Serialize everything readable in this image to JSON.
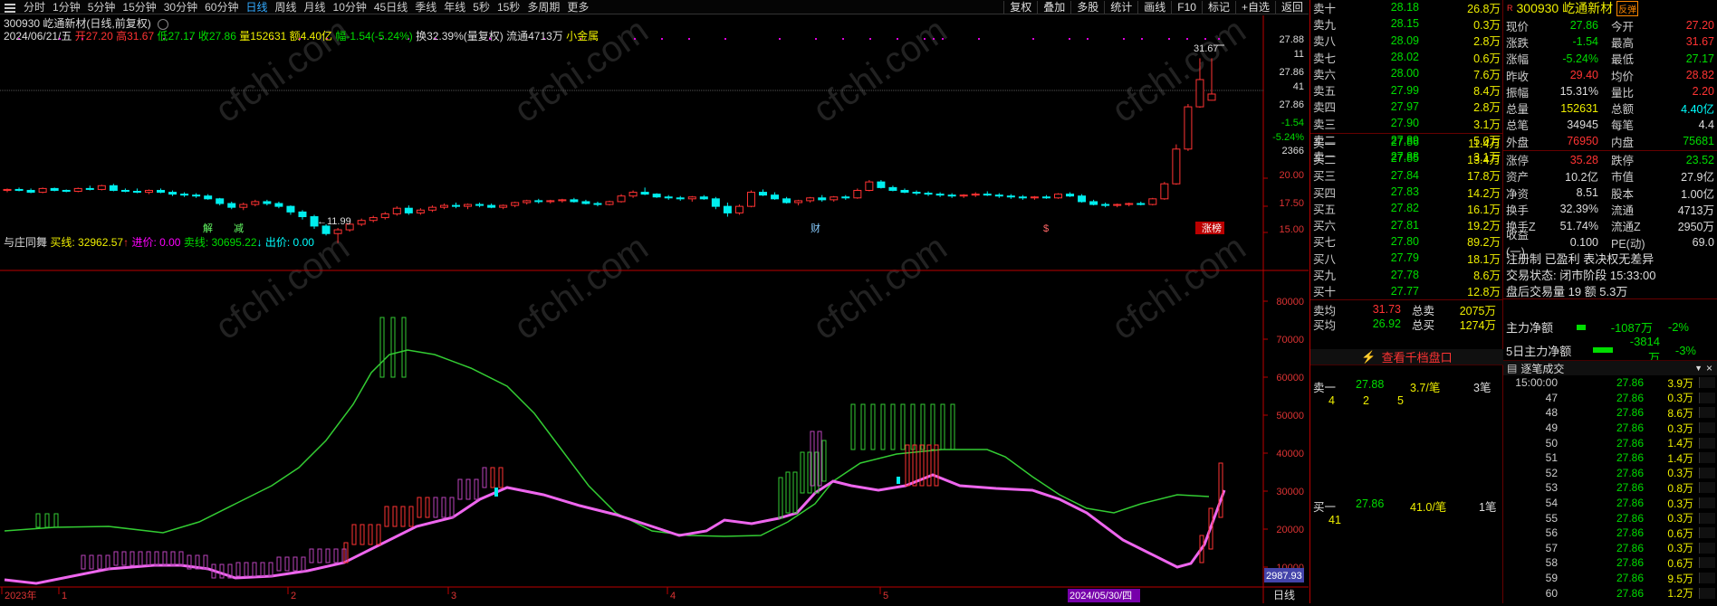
{
  "toolbar": {
    "periods": [
      "分时",
      "1分钟",
      "5分钟",
      "15分钟",
      "30分钟",
      "60分钟",
      "日线",
      "周线",
      "月线",
      "10分钟",
      "45日线",
      "季线",
      "年线",
      "5秒",
      "15秒",
      "多周期",
      "更多"
    ],
    "active": "日线",
    "buttons": [
      "复权",
      "叠加",
      "多股",
      "统计",
      "画线",
      "F10",
      "标记",
      "+自选",
      "返回"
    ]
  },
  "chart_header": {
    "title": "300930 屹通新材(日线,前复权)",
    "date": "2024/06/21/五",
    "open": "开27.20",
    "high": "高31.67",
    "low": "低27.17",
    "close": "收27.86",
    "volume": "量152631",
    "amount": "额4.40亿",
    "change": "幅-1.54(-5.24%)",
    "turnover": "换32.39%(量复权)",
    "float": "流通4713万",
    "tag": "小金属"
  },
  "price_axis": {
    "ticks": [
      "27.88",
      "11",
      "27.86",
      "41",
      "27.86",
      "-1.54",
      "-5.24%",
      "2366",
      "20.00",
      "17.50",
      "15.00"
    ]
  },
  "price_labels": {
    "high": "31.67",
    "low": "11.99"
  },
  "event_marks": [
    "解",
    "减",
    "财",
    "$",
    "涨榜"
  ],
  "indicator": {
    "name": "与庄同舞",
    "buy": "买线: 32962.57",
    "buy_arrow": "↑",
    "in_price": "进价: 0.00",
    "sell": "卖线: 30695.22",
    "sell_arrow": "↓",
    "out_price": "出价: 0.00",
    "yticks": [
      "80000",
      "70000",
      "60000",
      "50000",
      "40000",
      "30000",
      "20000",
      "10000"
    ],
    "cursor_value": "2987.93"
  },
  "xaxis": {
    "labels": [
      "2023年",
      "1",
      "2",
      "3",
      "4",
      "5"
    ],
    "date_label": "2024/05/30/四",
    "period_label": "日线"
  },
  "quote": {
    "code": "300930",
    "name": "屹通新材",
    "badge": "R",
    "tag": "反弹",
    "sells": [
      {
        "label": "卖十",
        "price": "28.18",
        "vol": "26.8万"
      },
      {
        "label": "卖九",
        "price": "28.15",
        "vol": "0.3万"
      },
      {
        "label": "卖八",
        "price": "28.09",
        "vol": "2.8万"
      },
      {
        "label": "卖七",
        "price": "28.02",
        "vol": "0.6万"
      },
      {
        "label": "卖六",
        "price": "28.00",
        "vol": "7.6万"
      },
      {
        "label": "卖五",
        "price": "27.99",
        "vol": "8.4万"
      },
      {
        "label": "卖四",
        "price": "27.97",
        "vol": "2.8万"
      },
      {
        "label": "卖三",
        "price": "27.90",
        "vol": "3.1万"
      },
      {
        "label": "卖二",
        "price": "27.89",
        "vol": "5.0万"
      },
      {
        "label": "卖一",
        "price": "27.88",
        "vol": "3.1万"
      }
    ],
    "buys": [
      {
        "label": "买一",
        "price": "27.86",
        "vol": "11.4万"
      },
      {
        "label": "买二",
        "price": "27.85",
        "vol": "13.4万"
      },
      {
        "label": "买三",
        "price": "27.84",
        "vol": "17.8万"
      },
      {
        "label": "买四",
        "price": "27.83",
        "vol": "14.2万"
      },
      {
        "label": "买五",
        "price": "27.82",
        "vol": "16.1万"
      },
      {
        "label": "买六",
        "price": "27.81",
        "vol": "19.2万"
      },
      {
        "label": "买七",
        "price": "27.80",
        "vol": "89.2万"
      },
      {
        "label": "买八",
        "price": "27.79",
        "vol": "18.1万"
      },
      {
        "label": "买九",
        "price": "27.78",
        "vol": "8.6万"
      },
      {
        "label": "买十",
        "price": "27.77",
        "vol": "12.8万"
      }
    ],
    "avg": [
      {
        "label": "卖均",
        "price": "31.73",
        "l2": "总卖",
        "v2": "2075万"
      },
      {
        "label": "买均",
        "price": "26.92",
        "l2": "总买",
        "v2": "1274万"
      }
    ],
    "stats": [
      {
        "l": "现价",
        "v": "27.86",
        "l2": "今开",
        "v2": "27.20"
      },
      {
        "l": "涨跌",
        "v": "-1.54",
        "l2": "最高",
        "v2": "31.67"
      },
      {
        "l": "涨幅",
        "v": "-5.24%",
        "l2": "最低",
        "v2": "27.17"
      },
      {
        "l": "昨收",
        "v": "29.40",
        "l2": "均价",
        "v2": "28.82"
      },
      {
        "l": "振幅",
        "v": "15.31%",
        "l2": "量比",
        "v2": "2.20"
      },
      {
        "l": "总量",
        "v": "152631",
        "l2": "总额",
        "v2": "4.40亿"
      },
      {
        "l": "总笔",
        "v": "34945",
        "l2": "每笔",
        "v2": "4.4"
      },
      {
        "l": "外盘",
        "v": "76950",
        "l2": "内盘",
        "v2": "75681"
      },
      {
        "l": "涨停",
        "v": "35.28",
        "l2": "跌停",
        "v2": "23.52"
      },
      {
        "l": "资产",
        "v": "10.2亿",
        "l2": "市值",
        "v2": "27.9亿"
      },
      {
        "l": "净资",
        "v": "8.51",
        "l2": "股本",
        "v2": "1.00亿"
      },
      {
        "l": "换手",
        "v": "32.39%",
        "l2": "流通",
        "v2": "4713万"
      },
      {
        "l": "换手Z",
        "v": "51.74%",
        "l2": "流通Z",
        "v2": "2950万"
      },
      {
        "l": "收益(一)",
        "v": "0.100",
        "l2": "PE(动)",
        "v2": "69.0"
      }
    ],
    "reg_text": "注册制 已盈利 表决权无差异",
    "trade_state": "交易状态: 闭市阶段 15:33:00",
    "after_hours": "盘后交易量 19 额 5.3万",
    "main_flow": {
      "l": "主力净额",
      "v": "-1087万",
      "p": "-2%"
    },
    "flow5": {
      "l": "5日主力净额",
      "v": "-3814万",
      "p": "-3%"
    }
  },
  "level2": {
    "header": "查看千档盘口",
    "sell1": {
      "label": "卖一",
      "price": "27.88",
      "vol": "3.7/笔",
      "count": "3笔",
      "detail": [
        "4",
        "2",
        "5"
      ]
    },
    "buy1": {
      "label": "买一",
      "price": "27.86",
      "vol": "41.0/笔",
      "count": "1笔",
      "detail": [
        "41"
      ]
    }
  },
  "ticks": {
    "title": "逐笔成交",
    "rows": [
      {
        "t": "15:00:00",
        "p": "27.86",
        "v": "3.9万"
      },
      {
        "t": "47",
        "p": "27.86",
        "v": "0.3万"
      },
      {
        "t": "48",
        "p": "27.86",
        "v": "8.6万"
      },
      {
        "t": "49",
        "p": "27.86",
        "v": "0.3万"
      },
      {
        "t": "50",
        "p": "27.86",
        "v": "1.4万"
      },
      {
        "t": "51",
        "p": "27.86",
        "v": "1.4万"
      },
      {
        "t": "52",
        "p": "27.86",
        "v": "0.3万"
      },
      {
        "t": "53",
        "p": "27.86",
        "v": "0.8万"
      },
      {
        "t": "54",
        "p": "27.86",
        "v": "0.3万"
      },
      {
        "t": "55",
        "p": "27.86",
        "v": "0.3万"
      },
      {
        "t": "56",
        "p": "27.86",
        "v": "0.6万"
      },
      {
        "t": "57",
        "p": "27.86",
        "v": "0.3万"
      },
      {
        "t": "58",
        "p": "27.86",
        "v": "0.6万"
      },
      {
        "t": "59",
        "p": "27.86",
        "v": "9.5万"
      },
      {
        "t": "60",
        "p": "27.86",
        "v": "1.2万"
      }
    ]
  },
  "watermark": "cfchi.com",
  "chart_data": {
    "type": "candlestick",
    "title": "300930 屹通新材(日线,前复权)",
    "ylim": [
      11,
      32
    ],
    "candles": [
      [
        17.6,
        17.8,
        17.4,
        17.7
      ],
      [
        17.7,
        17.9,
        17.5,
        17.6
      ],
      [
        17.6,
        17.8,
        17.3,
        17.4
      ],
      [
        17.4,
        17.9,
        17.3,
        17.8
      ],
      [
        17.8,
        17.9,
        17.5,
        17.6
      ],
      [
        17.6,
        17.7,
        17.4,
        17.5
      ],
      [
        17.5,
        17.9,
        17.4,
        17.8
      ],
      [
        17.8,
        18.1,
        17.6,
        17.7
      ],
      [
        17.7,
        18.2,
        17.6,
        18.1
      ],
      [
        18.1,
        18.3,
        17.5,
        17.6
      ],
      [
        17.6,
        17.8,
        17.4,
        17.5
      ],
      [
        17.5,
        17.8,
        17.3,
        17.4
      ],
      [
        17.4,
        17.7,
        17.2,
        17.6
      ],
      [
        17.6,
        17.8,
        17.3,
        17.4
      ],
      [
        17.4,
        17.6,
        17.0,
        17.2
      ],
      [
        17.2,
        17.4,
        16.9,
        17.1
      ],
      [
        17.1,
        17.3,
        16.8,
        17.0
      ],
      [
        17.0,
        17.2,
        16.6,
        16.7
      ],
      [
        16.7,
        16.8,
        16.0,
        16.2
      ],
      [
        16.2,
        16.4,
        15.6,
        15.8
      ],
      [
        15.8,
        16.3,
        15.5,
        16.1
      ],
      [
        16.1,
        16.6,
        15.9,
        16.4
      ],
      [
        16.4,
        16.6,
        16.0,
        16.2
      ],
      [
        16.2,
        16.4,
        15.7,
        15.9
      ],
      [
        15.9,
        16.0,
        15.0,
        15.3
      ],
      [
        15.3,
        15.5,
        14.5,
        14.8
      ],
      [
        14.8,
        15.0,
        13.5,
        13.8
      ],
      [
        13.8,
        14.0,
        12.8,
        13.0
      ],
      [
        13.0,
        13.6,
        11.99,
        13.4
      ],
      [
        13.4,
        14.2,
        13.2,
        14.0
      ],
      [
        14.0,
        14.6,
        13.8,
        14.4
      ],
      [
        14.4,
        14.9,
        14.2,
        14.7
      ],
      [
        14.7,
        15.3,
        14.5,
        15.1
      ],
      [
        15.1,
        15.9,
        14.9,
        15.7
      ],
      [
        15.7,
        16.0,
        15.0,
        15.2
      ],
      [
        15.2,
        15.7,
        15.0,
        15.5
      ],
      [
        15.5,
        16.0,
        15.3,
        15.8
      ],
      [
        15.8,
        16.2,
        15.6,
        16.0
      ],
      [
        16.0,
        16.3,
        15.7,
        15.9
      ],
      [
        15.9,
        16.2,
        15.6,
        16.1
      ],
      [
        16.1,
        16.3,
        15.8,
        16.0
      ],
      [
        16.0,
        16.2,
        15.7,
        15.8
      ],
      [
        15.8,
        16.1,
        15.6,
        16.0
      ],
      [
        16.0,
        16.4,
        15.8,
        16.3
      ],
      [
        16.3,
        16.6,
        16.1,
        16.5
      ],
      [
        16.5,
        16.7,
        16.2,
        16.4
      ],
      [
        16.4,
        16.6,
        16.2,
        16.5
      ],
      [
        16.5,
        16.7,
        16.3,
        16.6
      ],
      [
        16.6,
        16.8,
        16.3,
        16.4
      ],
      [
        16.4,
        16.6,
        16.1,
        16.2
      ],
      [
        16.2,
        16.4,
        15.9,
        16.1
      ],
      [
        16.1,
        16.5,
        16.0,
        16.4
      ],
      [
        16.4,
        17.2,
        16.3,
        17.0
      ],
      [
        17.0,
        17.6,
        16.8,
        17.4
      ],
      [
        17.4,
        17.9,
        17.1,
        17.2
      ],
      [
        17.2,
        17.3,
        16.8,
        16.9
      ],
      [
        16.9,
        17.1,
        16.6,
        16.8
      ],
      [
        16.8,
        17.0,
        16.5,
        16.7
      ],
      [
        16.7,
        17.0,
        16.4,
        16.9
      ],
      [
        16.9,
        17.1,
        16.6,
        16.7
      ],
      [
        16.7,
        16.9,
        15.6,
        15.9
      ],
      [
        15.9,
        16.3,
        14.8,
        15.2
      ],
      [
        15.2,
        16.1,
        15.0,
        15.9
      ],
      [
        15.9,
        17.6,
        15.8,
        17.4
      ],
      [
        17.4,
        17.7,
        17.0,
        17.1
      ],
      [
        17.1,
        17.4,
        16.6,
        16.7
      ],
      [
        16.7,
        16.9,
        16.2,
        16.3
      ],
      [
        16.3,
        16.6,
        16.0,
        16.5
      ],
      [
        16.5,
        16.9,
        16.3,
        16.8
      ],
      [
        16.8,
        17.1,
        16.4,
        16.6
      ],
      [
        16.6,
        17.0,
        16.4,
        16.9
      ],
      [
        16.9,
        17.1,
        16.6,
        16.8
      ],
      [
        16.8,
        17.8,
        16.7,
        17.6
      ],
      [
        17.6,
        18.7,
        17.5,
        18.5
      ],
      [
        18.5,
        18.7,
        17.8,
        17.9
      ],
      [
        17.9,
        18.1,
        17.5,
        17.6
      ],
      [
        17.6,
        17.8,
        17.3,
        17.4
      ],
      [
        17.4,
        17.6,
        17.1,
        17.3
      ],
      [
        17.3,
        17.5,
        17.0,
        17.2
      ],
      [
        17.2,
        17.4,
        16.9,
        17.1
      ],
      [
        17.1,
        17.3,
        16.8,
        17.0
      ],
      [
        17.0,
        17.2,
        16.8,
        17.1
      ],
      [
        17.1,
        17.4,
        16.9,
        17.2
      ],
      [
        17.2,
        17.5,
        17.0,
        17.1
      ],
      [
        17.1,
        17.3,
        16.8,
        17.0
      ],
      [
        17.0,
        17.2,
        16.7,
        16.9
      ],
      [
        16.9,
        17.1,
        16.6,
        16.8
      ],
      [
        16.8,
        17.0,
        16.6,
        16.9
      ],
      [
        16.9,
        17.1,
        16.7,
        16.8
      ],
      [
        16.8,
        17.3,
        16.7,
        17.2
      ],
      [
        17.2,
        17.4,
        16.9,
        17.0
      ],
      [
        17.0,
        17.2,
        16.3,
        16.4
      ],
      [
        16.4,
        16.6,
        16.0,
        16.1
      ],
      [
        16.1,
        16.3,
        15.8,
        16.0
      ],
      [
        16.0,
        16.2,
        15.8,
        16.1
      ],
      [
        16.1,
        16.3,
        15.9,
        16.2
      ],
      [
        16.2,
        16.4,
        16.0,
        16.1
      ],
      [
        16.1,
        16.8,
        16.0,
        16.7
      ],
      [
        16.7,
        18.5,
        16.6,
        18.3
      ],
      [
        18.3,
        22.5,
        18.2,
        22.0
      ],
      [
        22.0,
        26.8,
        21.8,
        26.5
      ],
      [
        26.5,
        31.67,
        26.4,
        29.4
      ],
      [
        27.2,
        31.67,
        27.17,
        27.86
      ]
    ]
  }
}
